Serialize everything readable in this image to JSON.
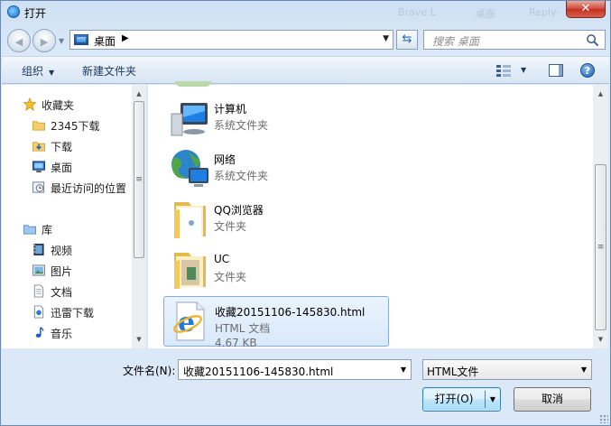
{
  "window": {
    "title": "打开",
    "close_label": "✕",
    "background_ghost": [
      "Brave L",
      "桌面",
      "Reply-"
    ]
  },
  "nav": {
    "back_label": "◀",
    "forward_label": "▶",
    "address": {
      "location": "桌面",
      "separator": "▶"
    },
    "search_placeholder": "搜索 桌面"
  },
  "toolbar": {
    "organize": "组织",
    "new_folder": "新建文件夹"
  },
  "sidebar": {
    "favorites_header": "收藏夹",
    "favorites": [
      {
        "label": "2345下载",
        "icon": "folder-icon"
      },
      {
        "label": "下载",
        "icon": "download-folder-icon"
      },
      {
        "label": "桌面",
        "icon": "desktop-icon"
      },
      {
        "label": "最近访问的位置",
        "icon": "recent-places-icon"
      }
    ],
    "libraries_header": "库",
    "libraries": [
      {
        "label": "视频",
        "icon": "video-icon"
      },
      {
        "label": "图片",
        "icon": "picture-icon"
      },
      {
        "label": "文档",
        "icon": "document-icon"
      },
      {
        "label": "迅雷下载",
        "icon": "thunder-download-icon"
      },
      {
        "label": "音乐",
        "icon": "music-icon"
      }
    ]
  },
  "files": [
    {
      "name": "计算机",
      "type": "系统文件夹",
      "size": "",
      "icon": "computer-icon",
      "selected": false
    },
    {
      "name": "网络",
      "type": "系统文件夹",
      "size": "",
      "icon": "network-icon",
      "selected": false
    },
    {
      "name": "QQ浏览器",
      "type": "文件夹",
      "size": "",
      "icon": "folder-icon",
      "selected": false
    },
    {
      "name": "UC",
      "type": "文件夹",
      "size": "",
      "icon": "folder-icon",
      "selected": false
    },
    {
      "name": "收藏20151106-145830.html",
      "type": "HTML 文档",
      "size": "4.67 KB",
      "icon": "ie-html-icon",
      "selected": true
    }
  ],
  "bottom": {
    "filename_label": "文件名(N):",
    "filename_value": "收藏20151106-145830.html",
    "filetype_value": "HTML文件",
    "open_label": "打开(O)",
    "cancel_label": "取消"
  },
  "colors": {
    "accent": "#3c7fb1",
    "selection": "#d8e9fb",
    "frame": "#dbe8f7"
  }
}
